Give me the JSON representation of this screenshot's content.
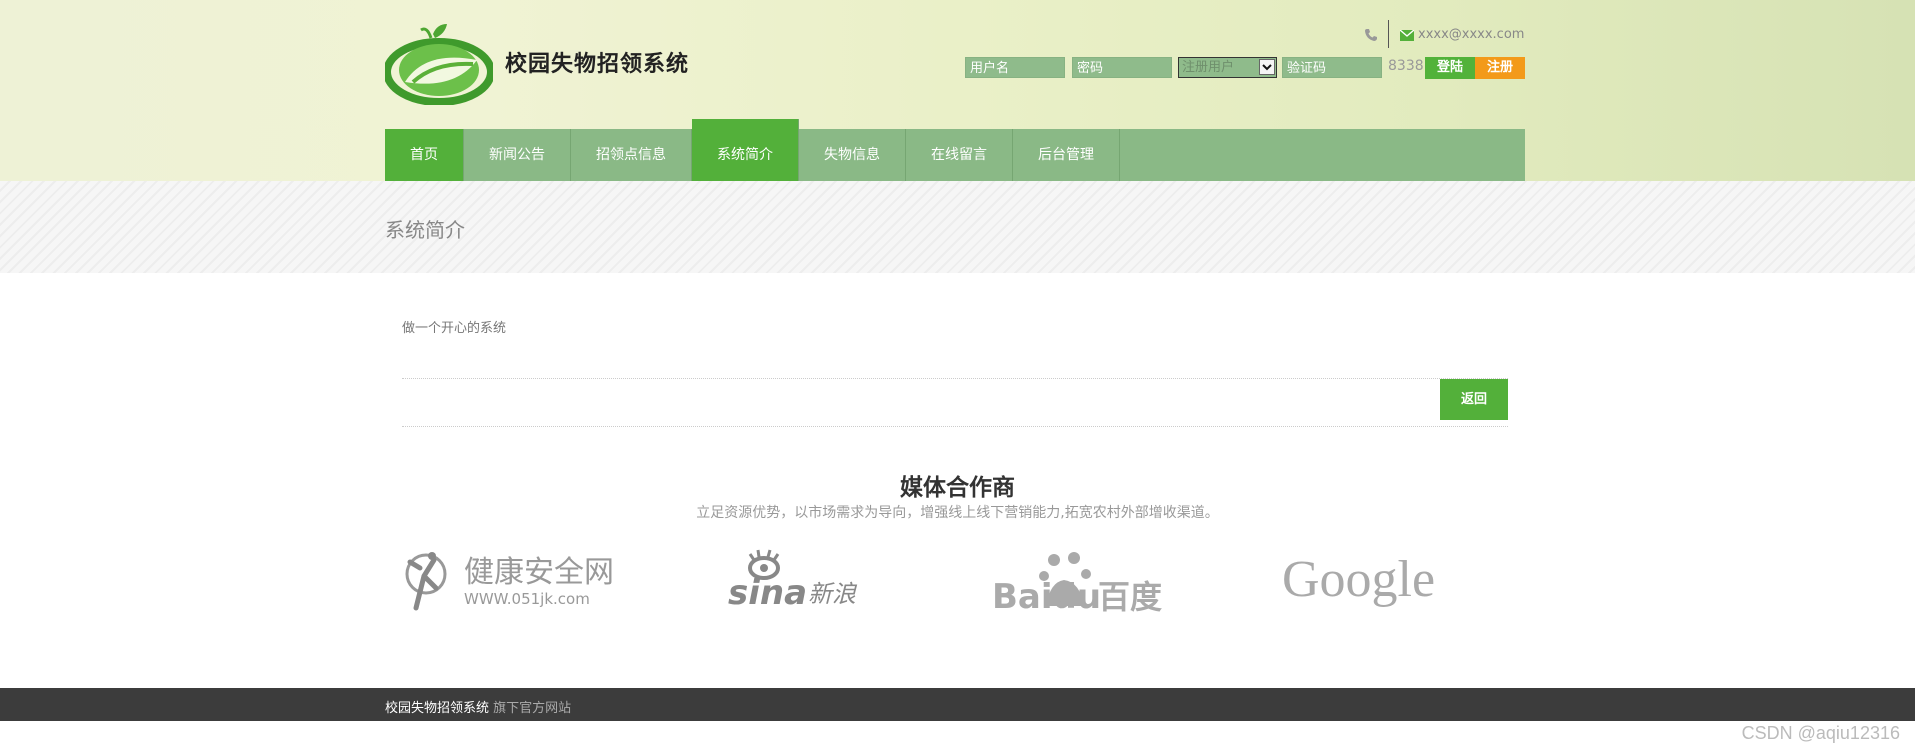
{
  "header": {
    "site_title": "校园失物招领系统",
    "phone_icon": "phone-icon",
    "email": "xxxx@xxxx.com",
    "login": {
      "username_placeholder": "用户名",
      "password_placeholder": "密码",
      "role_select_value": "注册用户",
      "captcha_placeholder": "验证码",
      "captcha_code": "8338",
      "login_button": "登陆",
      "register_button": "注册"
    }
  },
  "nav": {
    "items": [
      {
        "label": "首页"
      },
      {
        "label": "新闻公告"
      },
      {
        "label": "招领点信息"
      },
      {
        "label": "系统简介"
      },
      {
        "label": "失物信息"
      },
      {
        "label": "在线留言"
      },
      {
        "label": "后台管理"
      }
    ],
    "active": [
      "首页",
      "系统简介"
    ]
  },
  "banner": {
    "title": "系统简介"
  },
  "content": {
    "text": "做一个开心的系统",
    "back_button": "返回"
  },
  "partners": {
    "title": "媒体合作商",
    "subtitle": "立足资源优势，以市场需求为导向，增强线上线下营销能力,拓宽农村外部增收渠道。",
    "logos": [
      {
        "name": "jiankang-logo",
        "text": "健康安全网",
        "subtext": "WWW.051jk.com"
      },
      {
        "name": "sina-logo",
        "text": "sina",
        "subtext": "新浪"
      },
      {
        "name": "baidu-logo",
        "text": "Baidu",
        "subtext": "百度"
      },
      {
        "name": "google-logo",
        "text": "Google"
      }
    ]
  },
  "footer": {
    "site_name": "校园失物招领系统",
    "tagline": "旗下官方网站"
  },
  "watermark": "CSDN @aqiu12316",
  "colors": {
    "accent_green": "#53b03a",
    "nav_green": "#8ab986",
    "register_orange": "#f39a1a",
    "footer_dark": "#3c3c3c"
  }
}
